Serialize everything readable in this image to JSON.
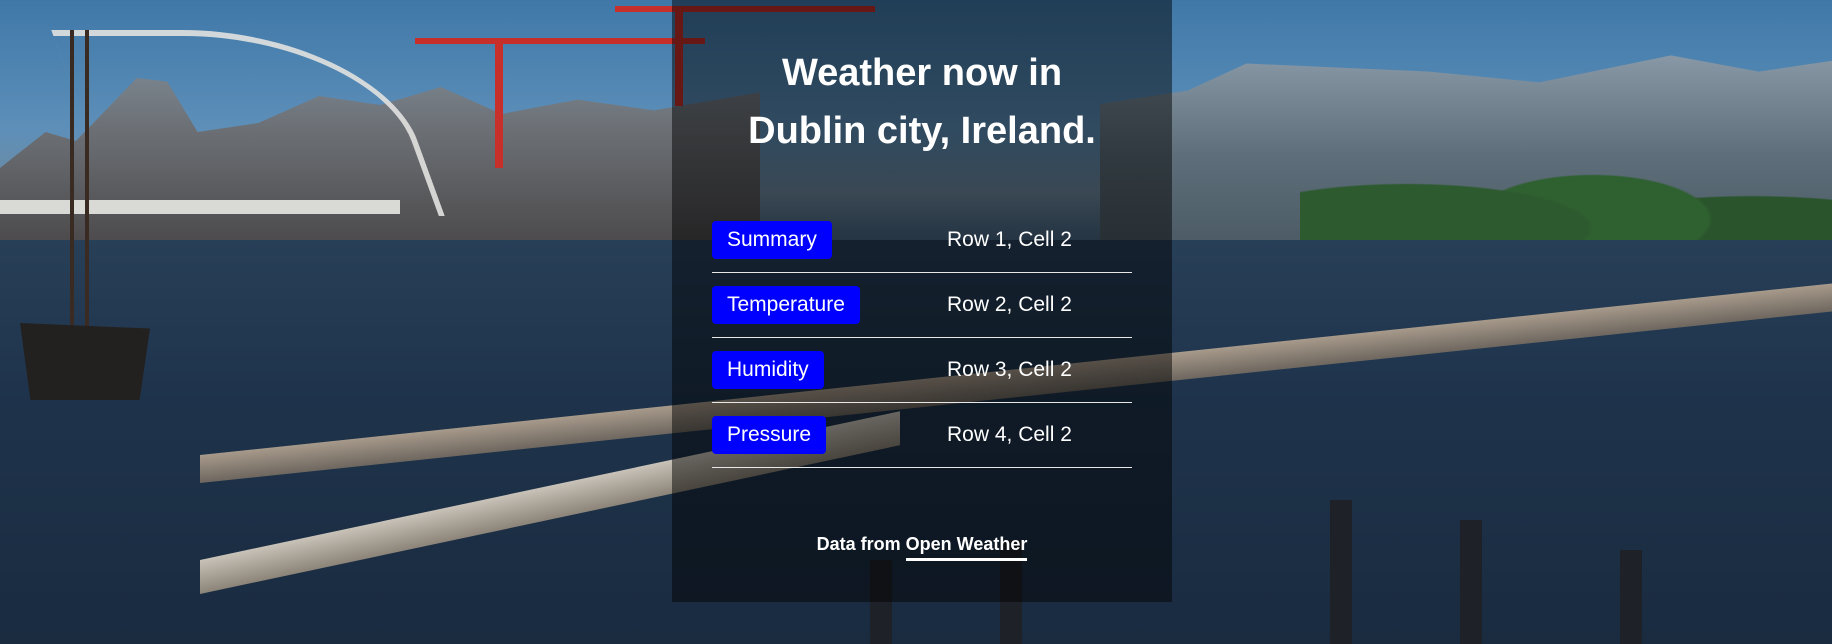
{
  "header": {
    "title_line1": "Weather now in",
    "title_line2": "Dublin city, Ireland."
  },
  "table": {
    "rows": [
      {
        "button": "Summary",
        "value": "Row 1, Cell 2"
      },
      {
        "button": "Temperature",
        "value": "Row 2, Cell 2"
      },
      {
        "button": "Humidity",
        "value": "Row 3, Cell 2"
      },
      {
        "button": "Pressure",
        "value": "Row 4, Cell 2"
      }
    ]
  },
  "footer": {
    "prefix": "Data from",
    "link_label": "Open Weather"
  },
  "colors": {
    "button_bg": "#0000ff",
    "panel_overlay": "rgba(0,0,0,0.48)",
    "text": "#ffffff"
  }
}
